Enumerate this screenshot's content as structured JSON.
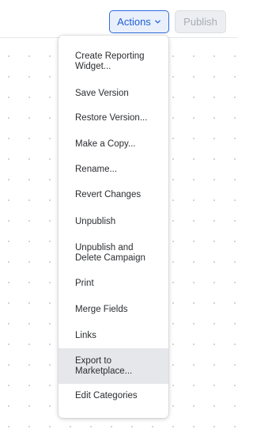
{
  "header": {
    "actions_label": "Actions",
    "publish_label": "Publish"
  },
  "menu": {
    "items": [
      {
        "label": "Create Reporting\nWidget..."
      },
      {
        "label": "Save Version"
      },
      {
        "label": "Restore Version..."
      },
      {
        "label": "Make a Copy..."
      },
      {
        "label": "Rename..."
      },
      {
        "label": "Revert Changes"
      },
      {
        "label": "Unpublish"
      },
      {
        "label": "Unpublish and\nDelete Campaign"
      },
      {
        "label": "Print"
      },
      {
        "label": "Merge Fields"
      },
      {
        "label": "Links"
      },
      {
        "label": "Export to\nMarketplace...",
        "highlighted": true
      },
      {
        "label": "Edit Categories"
      }
    ]
  },
  "colors": {
    "accent": "#2f6cdb",
    "highlight_bg": "#e6e7ea",
    "dot_grid": "#c9ccd1"
  }
}
